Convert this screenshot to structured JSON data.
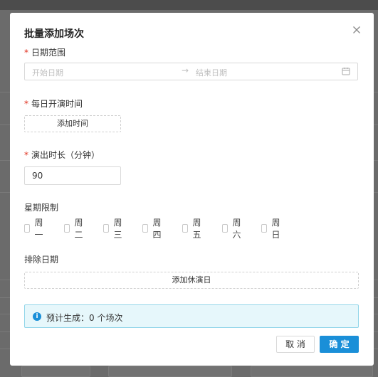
{
  "background": {
    "right_glyph_1": "t)",
    "right_glyph_2": "r"
  },
  "modal": {
    "title": "批量添加场次",
    "required_mark": "*",
    "date_range": {
      "label": "日期范围",
      "start_placeholder": "开始日期",
      "separator": "→",
      "end_placeholder": "结束日期"
    },
    "daily_time": {
      "label": "每日开演时间",
      "add_button": "添加时间"
    },
    "duration": {
      "label": "演出时长（分钟）",
      "value": "90"
    },
    "weekday_limit": {
      "label": "星期限制",
      "days": [
        {
          "label": "周一",
          "checked": false
        },
        {
          "label": "周二",
          "checked": false
        },
        {
          "label": "周三",
          "checked": false
        },
        {
          "label": "周四",
          "checked": false
        },
        {
          "label": "周五",
          "checked": false
        },
        {
          "label": "周六",
          "checked": false
        },
        {
          "label": "周日",
          "checked": false
        }
      ]
    },
    "exclude_dates": {
      "label": "排除日期",
      "add_button": "添加休演日"
    },
    "estimate": {
      "icon": "info-icon",
      "text": "预计生成：0 个场次"
    },
    "footer": {
      "cancel_label": "取 消",
      "confirm_label": "确 定"
    }
  },
  "colors": {
    "primary": "#1a8fd8",
    "required": "#e0301e",
    "info_bg": "#e6f7fb",
    "info_border": "#91d5e9"
  }
}
